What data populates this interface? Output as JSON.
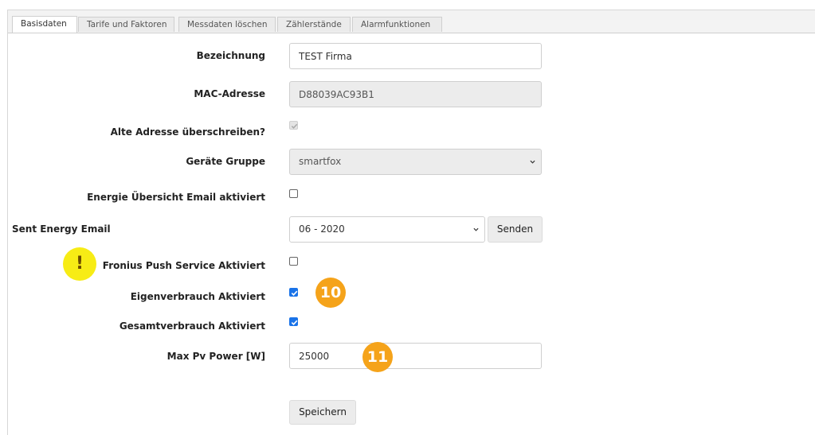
{
  "tabs": [
    {
      "label": "Basisdaten",
      "active": true
    },
    {
      "label": "Tarife und Faktoren",
      "active": false
    },
    {
      "label": "Messdaten löschen",
      "active": false
    },
    {
      "label": "Zählerstände",
      "active": false
    },
    {
      "label": "Alarmfunktionen",
      "active": false
    }
  ],
  "form": {
    "bezeichnung": {
      "label": "Bezeichnung",
      "value": "TEST Firma"
    },
    "mac": {
      "label": "MAC-Adresse",
      "value": "D88039AC93B1"
    },
    "overwrite": {
      "label": "Alte Adresse überschreiben?",
      "checked": true,
      "disabled": true
    },
    "group": {
      "label": "Geräte Gruppe",
      "value": "smartfox"
    },
    "energy_email": {
      "label": "Energie Übersicht Email aktiviert",
      "checked": false
    },
    "sent_email": {
      "label": "Sent Energy Email",
      "value": "06 - 2020",
      "button": "Senden"
    },
    "fronius": {
      "label": "Fronius Push Service Aktiviert",
      "checked": false
    },
    "eigenverbrauch": {
      "label": "Eigenverbrauch Aktiviert",
      "checked": true
    },
    "gesamtverbrauch": {
      "label": "Gesamtverbrauch Aktiviert",
      "checked": true
    },
    "max_pv": {
      "label": "Max Pv Power [W]",
      "value": "25000"
    },
    "save_label": "Speichern"
  },
  "annotations": {
    "warning": "!",
    "badge_10": "10",
    "badge_11": "11"
  },
  "colors": {
    "accent": "#1a73e8",
    "badge": "#f5a31a",
    "warning": "#f7ec15"
  }
}
